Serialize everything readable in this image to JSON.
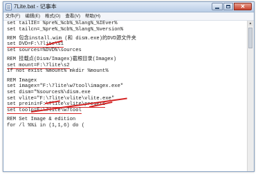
{
  "window": {
    "title": "7Lite.bat - 记事本",
    "buttons": {
      "minimize": "",
      "maximize": "",
      "close": "✕"
    }
  },
  "menu": [
    "文件(F)",
    "编辑(E)",
    "格式(O)",
    "查看(V)",
    "帮助(H)"
  ],
  "code": {
    "line1": "set tailIE= %pre%_%cb%_%lang%_%IEver%",
    "line2": "set tailcn=_%pre%_%cb%_%lang%_%version%",
    "line3": "REM 包含install.wim (和 dism.exe)的DVD源文件夹",
    "line4": "set DVD=F:\\7lite\\s1",
    "line5": "set sources=%DVD%\\sources",
    "line6": "REM 挂载点(Dism/Imagex)截根目录(Imagex)",
    "line7": "set mount=F:\\7lite\\s2",
    "line8": "if not exist %mount% mkdir %mount%",
    "line9": "REM Imagex",
    "line10": "set imagex=\"F:\\7lite\\w7tool\\imagex.exe\"",
    "line11": "set dism=\"%sources%\\dism.exe",
    "line12": "set vlite=\"F:\\7lite\\vlite\\vlite.exe\"",
    "line13": "set preini=F:\\7lite\\vlite\\presets",
    "line14": "set toolp=F:\\7lite\\w7tool",
    "line15": "REM Set Image & edition",
    "line16": "for /l %%i in (1,1,6) do ("
  },
  "colors": {
    "annotation": "#d42222",
    "titlebar": "#c6d6ec"
  }
}
